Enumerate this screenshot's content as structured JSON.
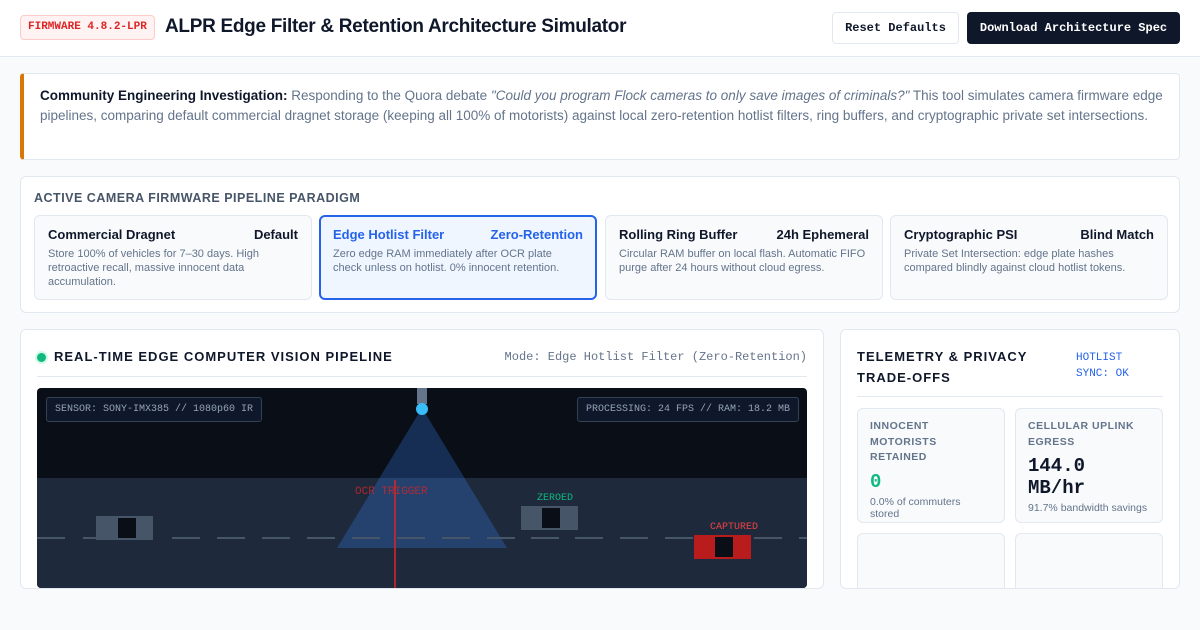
{
  "header": {
    "firmware_badge": "FIRMWARE 4.8.2-LPR",
    "title": "ALPR Edge Filter & Retention Architecture Simulator",
    "reset_label": "Reset Defaults",
    "download_label": "Download Architecture Spec"
  },
  "notice": {
    "label": "Community Engineering Investigation:",
    "lead": " Responding to the Quora debate ",
    "quote": "\"Could you program Flock cameras to only save images of criminals?\"",
    "rest": " This tool simulates camera firmware edge pipelines, comparing default commercial dragnet storage (keeping all 100% of motorists) against local zero-retention hotlist filters, ring buffers, and cryptographic private set intersections."
  },
  "paradigm": {
    "heading": "ACTIVE CAMERA FIRMWARE PIPELINE PARADIGM",
    "selected_index": 1,
    "options": [
      {
        "name": "Commercial Dragnet",
        "tag": "Default",
        "desc": "Store 100% of vehicles for 7–30 days. High retroactive recall, massive innocent data accumulation."
      },
      {
        "name": "Edge Hotlist Filter",
        "tag": "Zero-Retention",
        "desc": "Zero edge RAM immediately after OCR plate check unless on hotlist. 0% innocent retention."
      },
      {
        "name": "Rolling Ring Buffer",
        "tag": "24h Ephemeral",
        "desc": "Circular RAM buffer on local flash. Automatic FIFO purge after 24 hours without cloud egress."
      },
      {
        "name": "Cryptographic PSI",
        "tag": "Blind Match",
        "desc": "Private Set Intersection: edge plate hashes compared blindly against cloud hotlist tokens."
      }
    ]
  },
  "pipeline": {
    "title": "REAL-TIME EDGE COMPUTER VISION PIPELINE",
    "mode": "Mode: Edge Hotlist Filter (Zero-Retention)",
    "sensor_hud": "SENSOR: SONY-IMX385 // 1080p60 IR",
    "processing_hud": "PROCESSING: 24 FPS // RAM: 18.2 MB",
    "ocr_label": "OCR TRIGGER",
    "zeroed_label": "ZEROED",
    "captured_label": "CAPTURED",
    "colors": {
      "ocr": "#dc2626",
      "zeroed": "#10b981",
      "captured": "#ef4444",
      "camera": "#38bdf8"
    }
  },
  "telemetry": {
    "title": "TELEMETRY & PRIVACY TRADE-OFFS",
    "sync": "HOTLIST SYNC: OK",
    "metrics": [
      {
        "label": "INNOCENT MOTORISTS RETAINED",
        "value": "0",
        "sub": "0.0% of commuters stored",
        "color": "#10b981"
      },
      {
        "label": "CELLULAR UPLINK EGRESS",
        "value": "144.0 MB/hr",
        "sub": "91.7% bandwidth savings",
        "color": "#0f172a"
      }
    ]
  }
}
